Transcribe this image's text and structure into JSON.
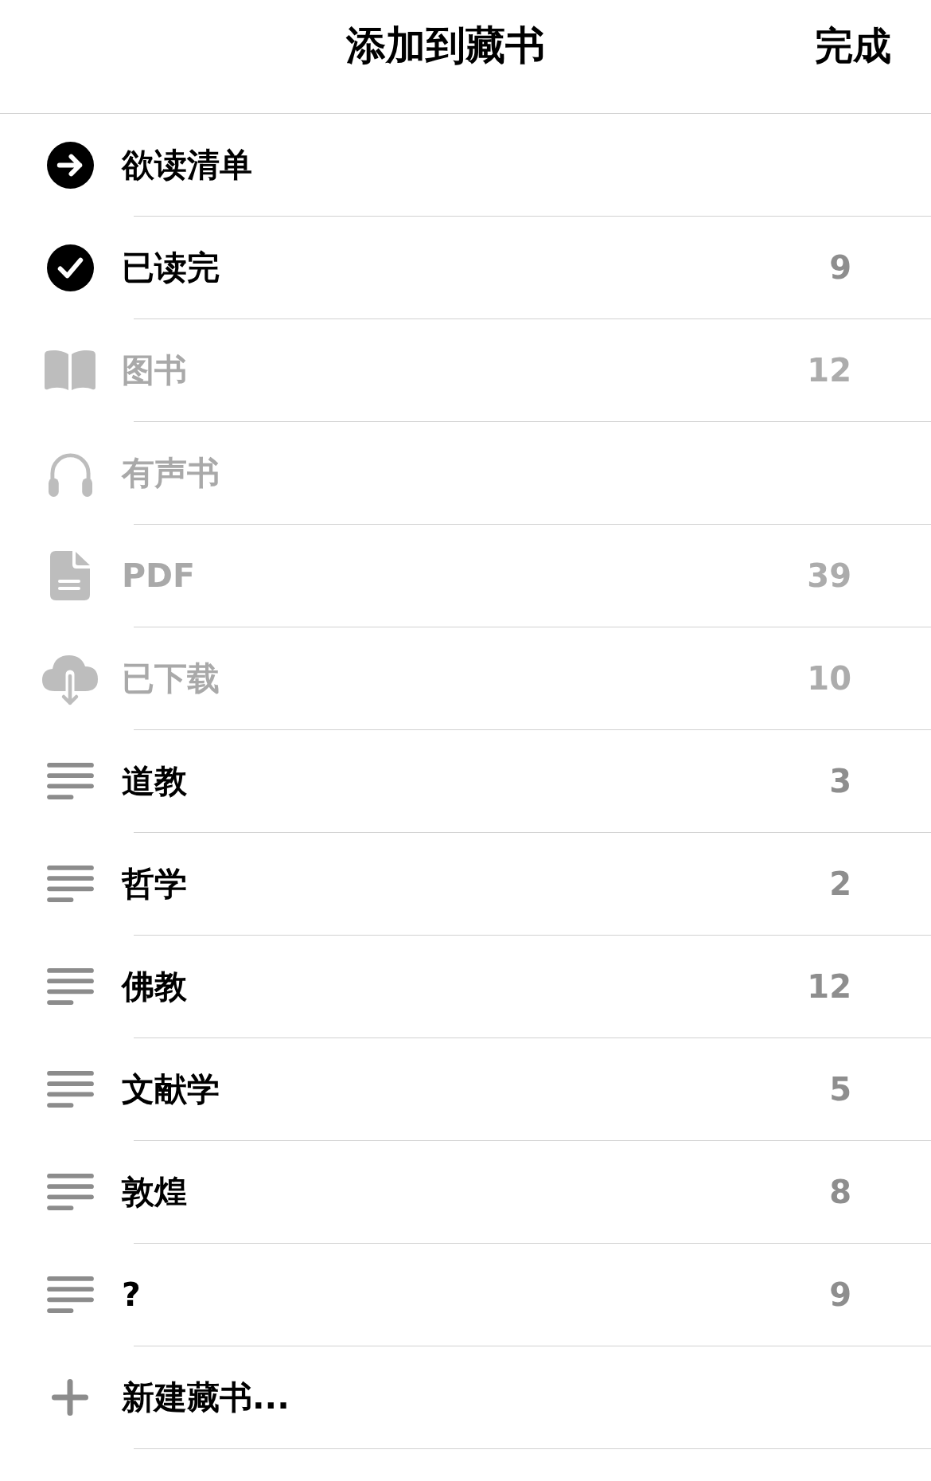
{
  "header": {
    "title": "添加到藏书",
    "done_button": "完成"
  },
  "collections": [
    {
      "kind": "arrow",
      "label": "欲读清单",
      "disabled": false
    },
    {
      "kind": "check",
      "label": "已读完",
      "count": "9",
      "disabled": false
    },
    {
      "kind": "book",
      "label": "图书",
      "count": "12",
      "disabled": true
    },
    {
      "kind": "headphones",
      "label": "有声书",
      "disabled": true
    },
    {
      "kind": "document",
      "label": "PDF",
      "count": "39",
      "disabled": true
    },
    {
      "kind": "cloud",
      "label": "已下载",
      "count": "10",
      "disabled": true
    },
    {
      "kind": "list",
      "label": "道教",
      "count": "3",
      "disabled": false
    },
    {
      "kind": "list",
      "label": "哲学",
      "count": "2",
      "disabled": false
    },
    {
      "kind": "list",
      "label": "佛教",
      "count": "12",
      "disabled": false
    },
    {
      "kind": "list",
      "label": "文献学",
      "count": "5",
      "disabled": false
    },
    {
      "kind": "list",
      "label": "敦煌",
      "count": "8",
      "disabled": false
    },
    {
      "kind": "list",
      "label": "?",
      "count": "9",
      "disabled": false
    }
  ],
  "new_collection": {
    "label": "新建藏书..."
  }
}
